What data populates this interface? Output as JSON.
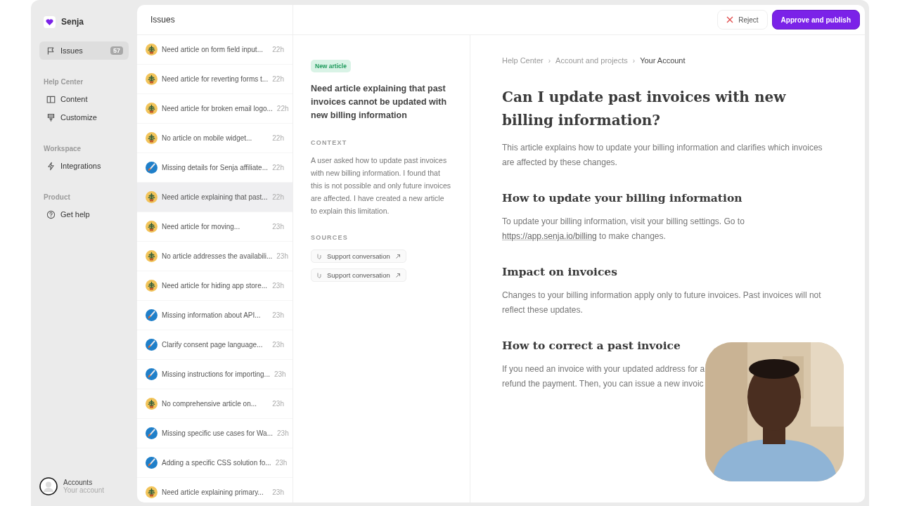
{
  "sidebar": {
    "brand": "Senja",
    "nav": [
      {
        "label": "Issues",
        "kind": "flag",
        "badge": "57",
        "selected": true
      }
    ],
    "sections": [
      {
        "title": "Help Center",
        "items": [
          {
            "label": "Content",
            "kind": "book",
            "selected": false
          },
          {
            "label": "Customize",
            "kind": "roller",
            "selected": false
          }
        ]
      },
      {
        "title": "Workspace",
        "items": [
          {
            "label": "Integrations",
            "kind": "bolt",
            "selected": false
          }
        ]
      },
      {
        "title": "Product",
        "items": [
          {
            "label": "Get help",
            "kind": "help",
            "selected": false
          }
        ]
      }
    ],
    "account": {
      "name": "Accounts",
      "subtitle": "Your account"
    }
  },
  "issues": {
    "title": "Issues",
    "items": [
      {
        "kind": "plant",
        "title": "Need article on form field input...",
        "time": "22h",
        "selected": false
      },
      {
        "kind": "plant",
        "title": "Need article for reverting forms t...",
        "time": "22h",
        "selected": false
      },
      {
        "kind": "plant",
        "title": "Need article for broken email logo...",
        "time": "22h",
        "selected": false
      },
      {
        "kind": "plant",
        "title": "No article on mobile widget...",
        "time": "22h",
        "selected": false
      },
      {
        "kind": "brush",
        "title": "Missing details for Senja affiliate...",
        "time": "22h",
        "selected": false
      },
      {
        "kind": "plant",
        "title": "Need article explaining that past...",
        "time": "22h",
        "selected": true
      },
      {
        "kind": "plant",
        "title": "Need article for moving...",
        "time": "23h",
        "selected": false
      },
      {
        "kind": "plant",
        "title": "No article addresses the availabili...",
        "time": "23h",
        "selected": false
      },
      {
        "kind": "plant",
        "title": "Need article for hiding app store...",
        "time": "23h",
        "selected": false
      },
      {
        "kind": "brush",
        "title": "Missing information about API...",
        "time": "23h",
        "selected": false
      },
      {
        "kind": "brush",
        "title": "Clarify consent page language...",
        "time": "23h",
        "selected": false
      },
      {
        "kind": "brush",
        "title": "Missing instructions for importing...",
        "time": "23h",
        "selected": false
      },
      {
        "kind": "plant",
        "title": "No comprehensive article on...",
        "time": "23h",
        "selected": false
      },
      {
        "kind": "brush",
        "title": "Missing specific use cases for Wa...",
        "time": "23h",
        "selected": false
      },
      {
        "kind": "brush",
        "title": "Adding a specific CSS solution fo...",
        "time": "23h",
        "selected": false
      },
      {
        "kind": "plant",
        "title": "Need article explaining primary...",
        "time": "23h",
        "selected": false
      }
    ]
  },
  "toolbar": {
    "buttons": [
      {
        "kind": "reject",
        "label": "Reject"
      },
      {
        "kind": "primary",
        "label": "Approve and publish"
      }
    ]
  },
  "detail": {
    "tag": "New article",
    "title": "Need article explaining that past invoices cannot be updated with new billing information",
    "context_heading": "CONTEXT",
    "context": "A user asked how to update past invoices with new billing information. I found that this is not possible and only future invoices are affected. I have created a new article to explain this limitation.",
    "sources_heading": "SOURCES",
    "sources": [
      "Support conversation",
      "Support conversation"
    ]
  },
  "article": {
    "breadcrumbs": [
      "Help Center",
      "Account and projects",
      "Your Account"
    ],
    "breadcrumb_separator": "›",
    "title": "Can I update past invoices with new billing information?",
    "intro": "This article explains how to update your billing information and clarifies which invoices are affected by these changes.",
    "sections": [
      {
        "heading": "How to update your billing information",
        "text": "To update your billing information, visit your billing settings. Go to",
        "link": "https://app.senja.io/billing",
        "text_after": "to make changes."
      },
      {
        "heading": "Impact on invoices",
        "text": "Changes to your billing information apply only to future invoices. Past invoices will not reflect these updates."
      },
      {
        "heading": "How to correct a past invoice",
        "lines": [
          "If you need an invoice with your updated address for a",
          "refund the payment. Then, you can issue a new invoic"
        ]
      }
    ]
  }
}
